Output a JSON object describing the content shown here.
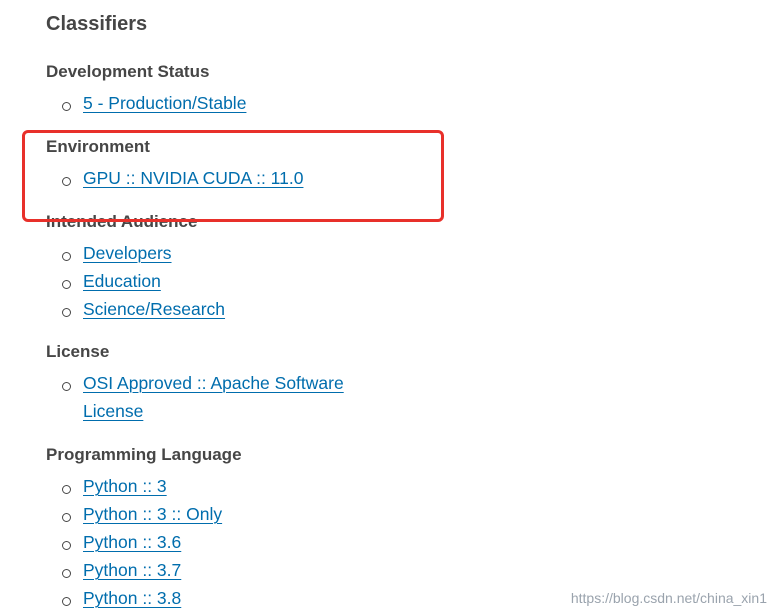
{
  "title": "Classifiers",
  "groups": [
    {
      "name": "Development Status",
      "items": [
        "5 - Production/Stable"
      ]
    },
    {
      "name": "Environment",
      "items": [
        "GPU :: NVIDIA CUDA :: 11.0"
      ]
    },
    {
      "name": "Intended Audience",
      "items": [
        "Developers",
        "Education",
        "Science/Research"
      ]
    },
    {
      "name": "License",
      "items": [
        "OSI Approved :: Apache Software License"
      ]
    },
    {
      "name": "Programming Language",
      "items": [
        "Python :: 3",
        "Python :: 3 :: Only",
        "Python :: 3.6",
        "Python :: 3.7",
        "Python :: 3.8"
      ]
    }
  ],
  "highlight_color": "#e8302a",
  "link_color": "#006dad",
  "watermark": "https://blog.csdn.net/china_xin1"
}
